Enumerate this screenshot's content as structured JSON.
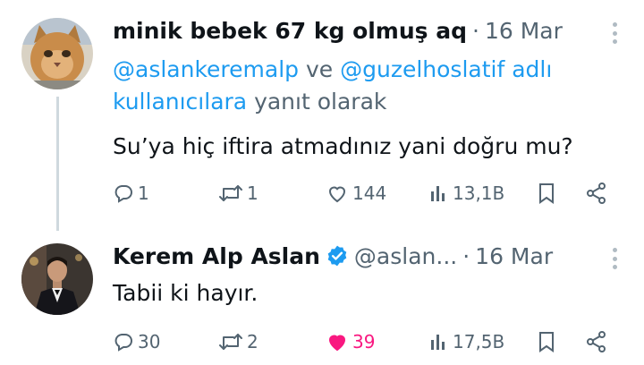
{
  "tweets": [
    {
      "author_name": "minik bebek 67 kg olmuş aq",
      "handle": "",
      "date": "16 Mar",
      "separator": "·",
      "avatar": "cat-avatar",
      "replying_to": {
        "mention_1": "@aslankeremalp",
        "connector": " ve ",
        "mention_2": "@guzelhoslatif",
        "mention_suffix": " adlı kullanıcılara",
        "suffix": " yanıt olarak"
      },
      "text": "Su’ya hiç iftira atmadınız yani doğru mu?",
      "stats": {
        "replies": "1",
        "retweets": "1",
        "likes": "144",
        "views": "13,1B"
      },
      "liked": false
    },
    {
      "author_name": "Kerem Alp Aslan",
      "verified": true,
      "handle": "@aslan...",
      "date": "16 Mar",
      "separator": "·",
      "avatar": "man-in-suit-avatar",
      "text": "Tabii ki hayır.",
      "stats": {
        "replies": "30",
        "retweets": "2",
        "likes": "39",
        "views": "17,5B"
      },
      "liked": true
    }
  ],
  "icons": {
    "reply": "reply-icon",
    "retweet": "retweet-icon",
    "like": "heart-icon",
    "views": "views-icon",
    "bookmark": "bookmark-icon",
    "share": "share-icon",
    "more": "more-icon",
    "verified": "verified-badge-icon"
  },
  "colors": {
    "text": "#0f1419",
    "secondary": "#536471",
    "link": "#1d9bf0",
    "like_active": "#f91880",
    "verified": "#1d9bf0",
    "thread_line": "#cfd9de"
  }
}
